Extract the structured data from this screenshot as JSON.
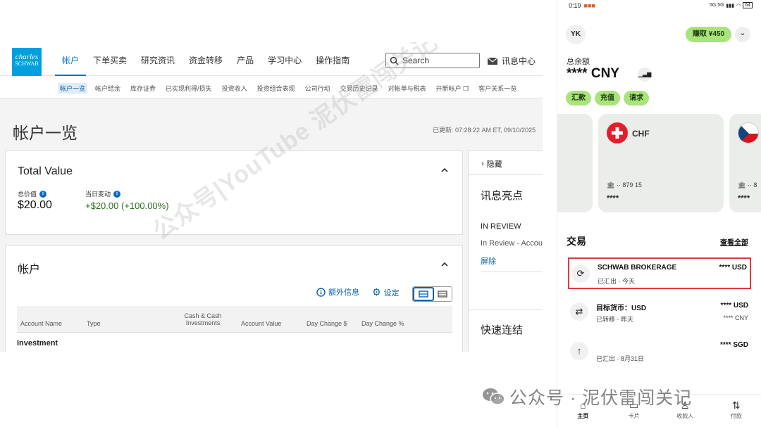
{
  "schwab": {
    "logo_line1": "charles",
    "logo_line2": "SCHWAB",
    "nav": [
      "帐户",
      "下单买卖",
      "研究资讯",
      "资金转移",
      "产品",
      "学习中心",
      "操作指南"
    ],
    "search_placeholder": "Search",
    "message_center": "讯息中心",
    "subnav": [
      "帐户一览",
      "帐户结余",
      "库存证券",
      "已实现利得/损失",
      "投资收入",
      "投资组合表现",
      "公司行动",
      "交易历史记录",
      "对帐单与税表",
      "开新帐户",
      "客户关系一览"
    ],
    "page_title": "帐户一览",
    "updated": "已更新: 07:28:22 AM ET, 09/10/2025",
    "total_value": {
      "title": "Total Value",
      "total_label": "总价值",
      "total_value": "$20.00",
      "daychange_label": "当日变动",
      "daychange_value": "+$20.00 (+100.00%)"
    },
    "accounts": {
      "title": "帐户",
      "extra_info": "额外信息",
      "settings": "设定",
      "columns": [
        "Account Name",
        "Type",
        "Cash & Cash Investments",
        "Account Value",
        "Day Change $",
        "Day Change %"
      ],
      "group": "Investment"
    },
    "side": {
      "hide": "隐藏",
      "highlights_title": "讯息亮点",
      "status": "IN REVIEW",
      "status_detail": "In Review - Accou",
      "dismiss": "屏除",
      "quicklinks_title": "快速连结"
    },
    "watermark": "公众号|YouTube 泥伏雷闯关记"
  },
  "mobile": {
    "time": "0:19",
    "status_icons": "5G 5G",
    "battery": "64",
    "avatar": "YK",
    "earn": "赚取 ¥450",
    "balance_label": "总余额",
    "balance_value": "**** CNY",
    "actions": [
      "汇款",
      "充值",
      "请求"
    ],
    "cards": [
      {
        "currency": "CHF",
        "account": "🏛 ·· 879 15",
        "stars": "****"
      },
      {
        "currency": "",
        "account": "🏛 ·· 8",
        "stars": "****"
      }
    ],
    "tx_header": "交易",
    "see_all": "查看全部",
    "transactions": [
      {
        "name": "SCHWAB BROKERAGE",
        "sub": "已汇出 · 今天",
        "amount": "**** USD",
        "amount2": "",
        "icon": "refresh-icon"
      },
      {
        "name": "目标货币：USD",
        "sub": "已转移 · 昨天",
        "amount": "**** USD",
        "amount2": "**** CNY",
        "icon": "exchange-icon"
      },
      {
        "name": "",
        "sub": "已汇出 · 8月31日",
        "amount": "**** SGD",
        "amount2": "",
        "icon": "send-icon"
      }
    ],
    "tabs": [
      "主页",
      "卡片",
      "收款人",
      "付款"
    ]
  },
  "wechat_watermark": "公众号 · 泥伏雷闯关记",
  "colors": {
    "schwab_blue": "#0072c6",
    "logo_bg": "#00a0df",
    "wise_green": "#a8e47b",
    "gain_green": "#2f6d1d",
    "highlight_red": "#e0393e"
  }
}
